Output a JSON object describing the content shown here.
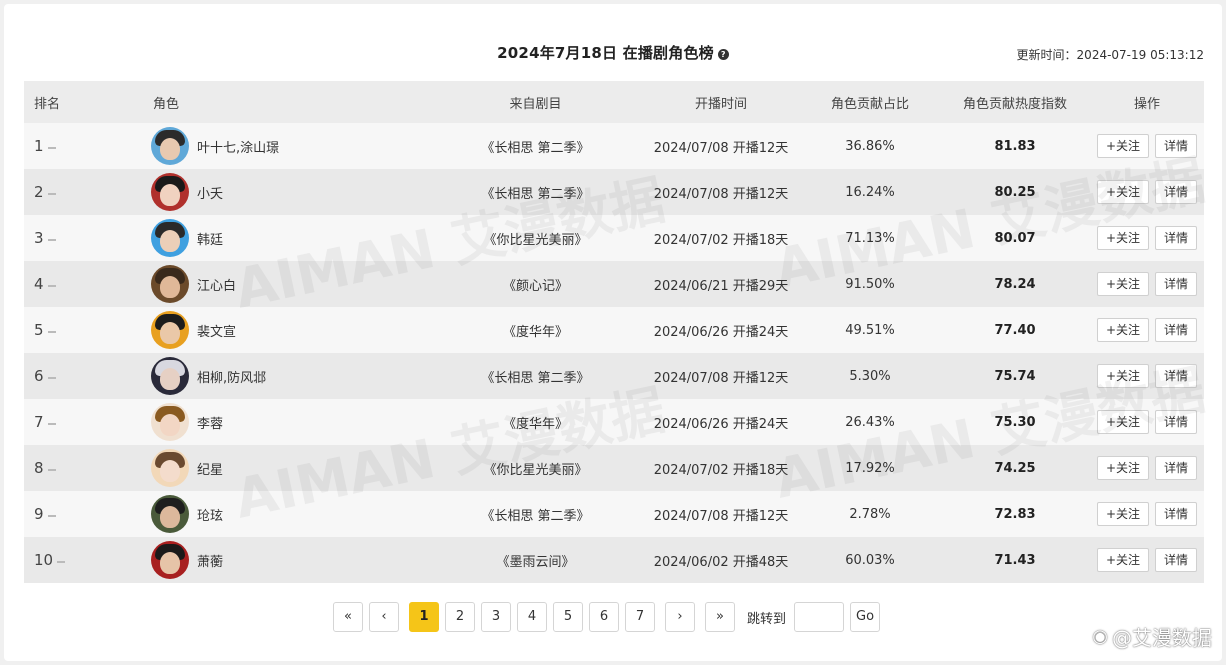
{
  "header": {
    "title": "2024年7月18日 在播剧角色榜",
    "help_icon": "?",
    "update_label": "更新时间：2024-07-19 05:13:12"
  },
  "columns": [
    "排名",
    "角色",
    "来自剧目",
    "开播时间",
    "角色贡献占比",
    "角色贡献热度指数",
    "操作"
  ],
  "rows": [
    {
      "rank": "1",
      "name": "叶十七,涂山璟",
      "drama": "《长相思 第二季》",
      "date": "2024/07/08 开播12天",
      "pct": "36.86%",
      "heat": "81.83",
      "hair": "#2b2b2b",
      "skin": "#e8c9b0",
      "bg": "#5fa8d8"
    },
    {
      "rank": "2",
      "name": "小夭",
      "drama": "《长相思 第二季》",
      "date": "2024/07/08 开播12天",
      "pct": "16.24%",
      "heat": "80.25",
      "hair": "#1a1a1a",
      "skin": "#f0d2c0",
      "bg": "#b0302c"
    },
    {
      "rank": "3",
      "name": "韩廷",
      "drama": "《你比星光美丽》",
      "date": "2024/07/02 开播18天",
      "pct": "71.13%",
      "heat": "80.07",
      "hair": "#2a2a2a",
      "skin": "#eccfb8",
      "bg": "#3fa0e0"
    },
    {
      "rank": "4",
      "name": "江心白",
      "drama": "《颜心记》",
      "date": "2024/06/21 开播29天",
      "pct": "91.50%",
      "heat": "78.24",
      "hair": "#3a2a1c",
      "skin": "#e0b898",
      "bg": "#6b4a2a"
    },
    {
      "rank": "5",
      "name": "裴文宣",
      "drama": "《度华年》",
      "date": "2024/06/26 开播24天",
      "pct": "49.51%",
      "heat": "77.40",
      "hair": "#1c1c1c",
      "skin": "#eac8a8",
      "bg": "#e8a020"
    },
    {
      "rank": "6",
      "name": "相柳,防风邶",
      "drama": "《长相思 第二季》",
      "date": "2024/07/08 开播12天",
      "pct": "5.30%",
      "heat": "75.74",
      "hair": "#d8d8e0",
      "skin": "#e6d0c4",
      "bg": "#2a2a3a"
    },
    {
      "rank": "7",
      "name": "李蓉",
      "drama": "《度华年》",
      "date": "2024/06/26 开播24天",
      "pct": "26.43%",
      "heat": "75.30",
      "hair": "#8a5a20",
      "skin": "#f2d6c4",
      "bg": "#f0e0d0"
    },
    {
      "rank": "8",
      "name": "纪星",
      "drama": "《你比星光美丽》",
      "date": "2024/07/02 开播18天",
      "pct": "17.92%",
      "heat": "74.25",
      "hair": "#6a4a30",
      "skin": "#f4dccc",
      "bg": "#f2d8b8"
    },
    {
      "rank": "9",
      "name": "玱玹",
      "drama": "《长相思 第二季》",
      "date": "2024/07/08 开播12天",
      "pct": "2.78%",
      "heat": "72.83",
      "hair": "#1e1e1e",
      "skin": "#dcb89c",
      "bg": "#4a5a3a"
    },
    {
      "rank": "10",
      "name": "萧蘅",
      "drama": "《墨雨云间》",
      "date": "2024/06/02 开播48天",
      "pct": "60.03%",
      "heat": "71.43",
      "hair": "#1a1a1a",
      "skin": "#e6c4a8",
      "bg": "#a82020"
    }
  ],
  "buttons": {
    "follow": "+关注",
    "detail": "详情"
  },
  "pagination": {
    "first": "«",
    "prev": "‹",
    "pages": [
      "1",
      "2",
      "3",
      "4",
      "5",
      "6",
      "7"
    ],
    "active_page": "1",
    "next": "›",
    "last": "»",
    "jump_label": "跳转到",
    "go": "Go"
  },
  "watermark": "AIMAN 艾漫数据",
  "brand": {
    "weibo_icon": "weibo-icon",
    "text": "@艾漫数据"
  },
  "colors": {
    "accent": "#f5c518"
  }
}
